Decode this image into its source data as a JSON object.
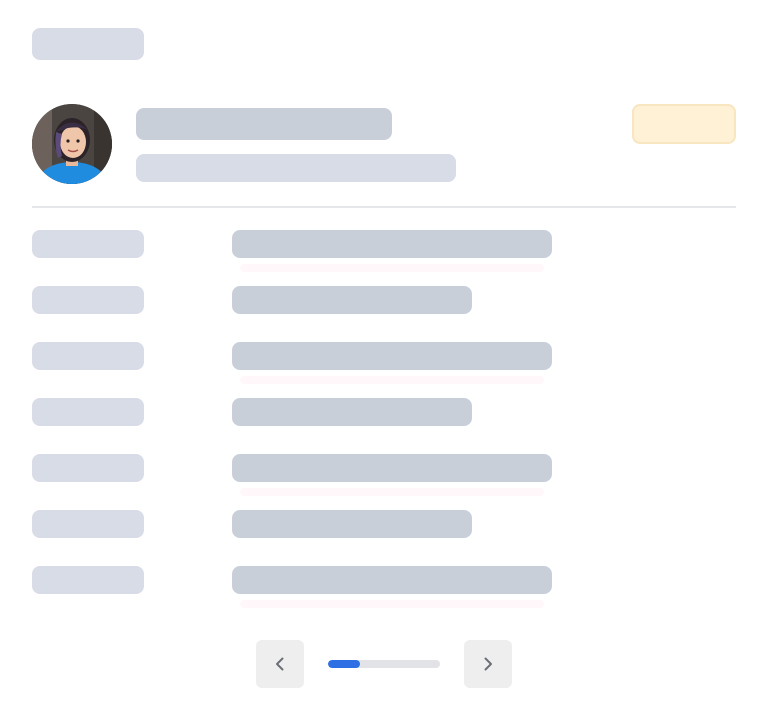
{
  "header": {
    "chip_label": ""
  },
  "profile": {
    "avatar_alt": "User avatar",
    "name": "",
    "subtitle": "",
    "status_badge": ""
  },
  "details": {
    "rows": [
      {
        "label": "",
        "value": "",
        "width": "long"
      },
      {
        "label": "",
        "value": "",
        "width": "short"
      },
      {
        "label": "",
        "value": "",
        "width": "long"
      },
      {
        "label": "",
        "value": "",
        "width": "short"
      },
      {
        "label": "",
        "value": "",
        "width": "long"
      },
      {
        "label": "",
        "value": "",
        "width": "short"
      },
      {
        "label": "",
        "value": "",
        "width": "long"
      }
    ]
  },
  "pagination": {
    "prev_icon": "chevron-left-icon",
    "next_icon": "chevron-right-icon",
    "progress": 0.29
  },
  "colors": {
    "skeleton_dark": "#c9cfd9",
    "skeleton_light": "#d8dce6",
    "badge": "#fff1d6",
    "accent": "#2f6fe4"
  }
}
